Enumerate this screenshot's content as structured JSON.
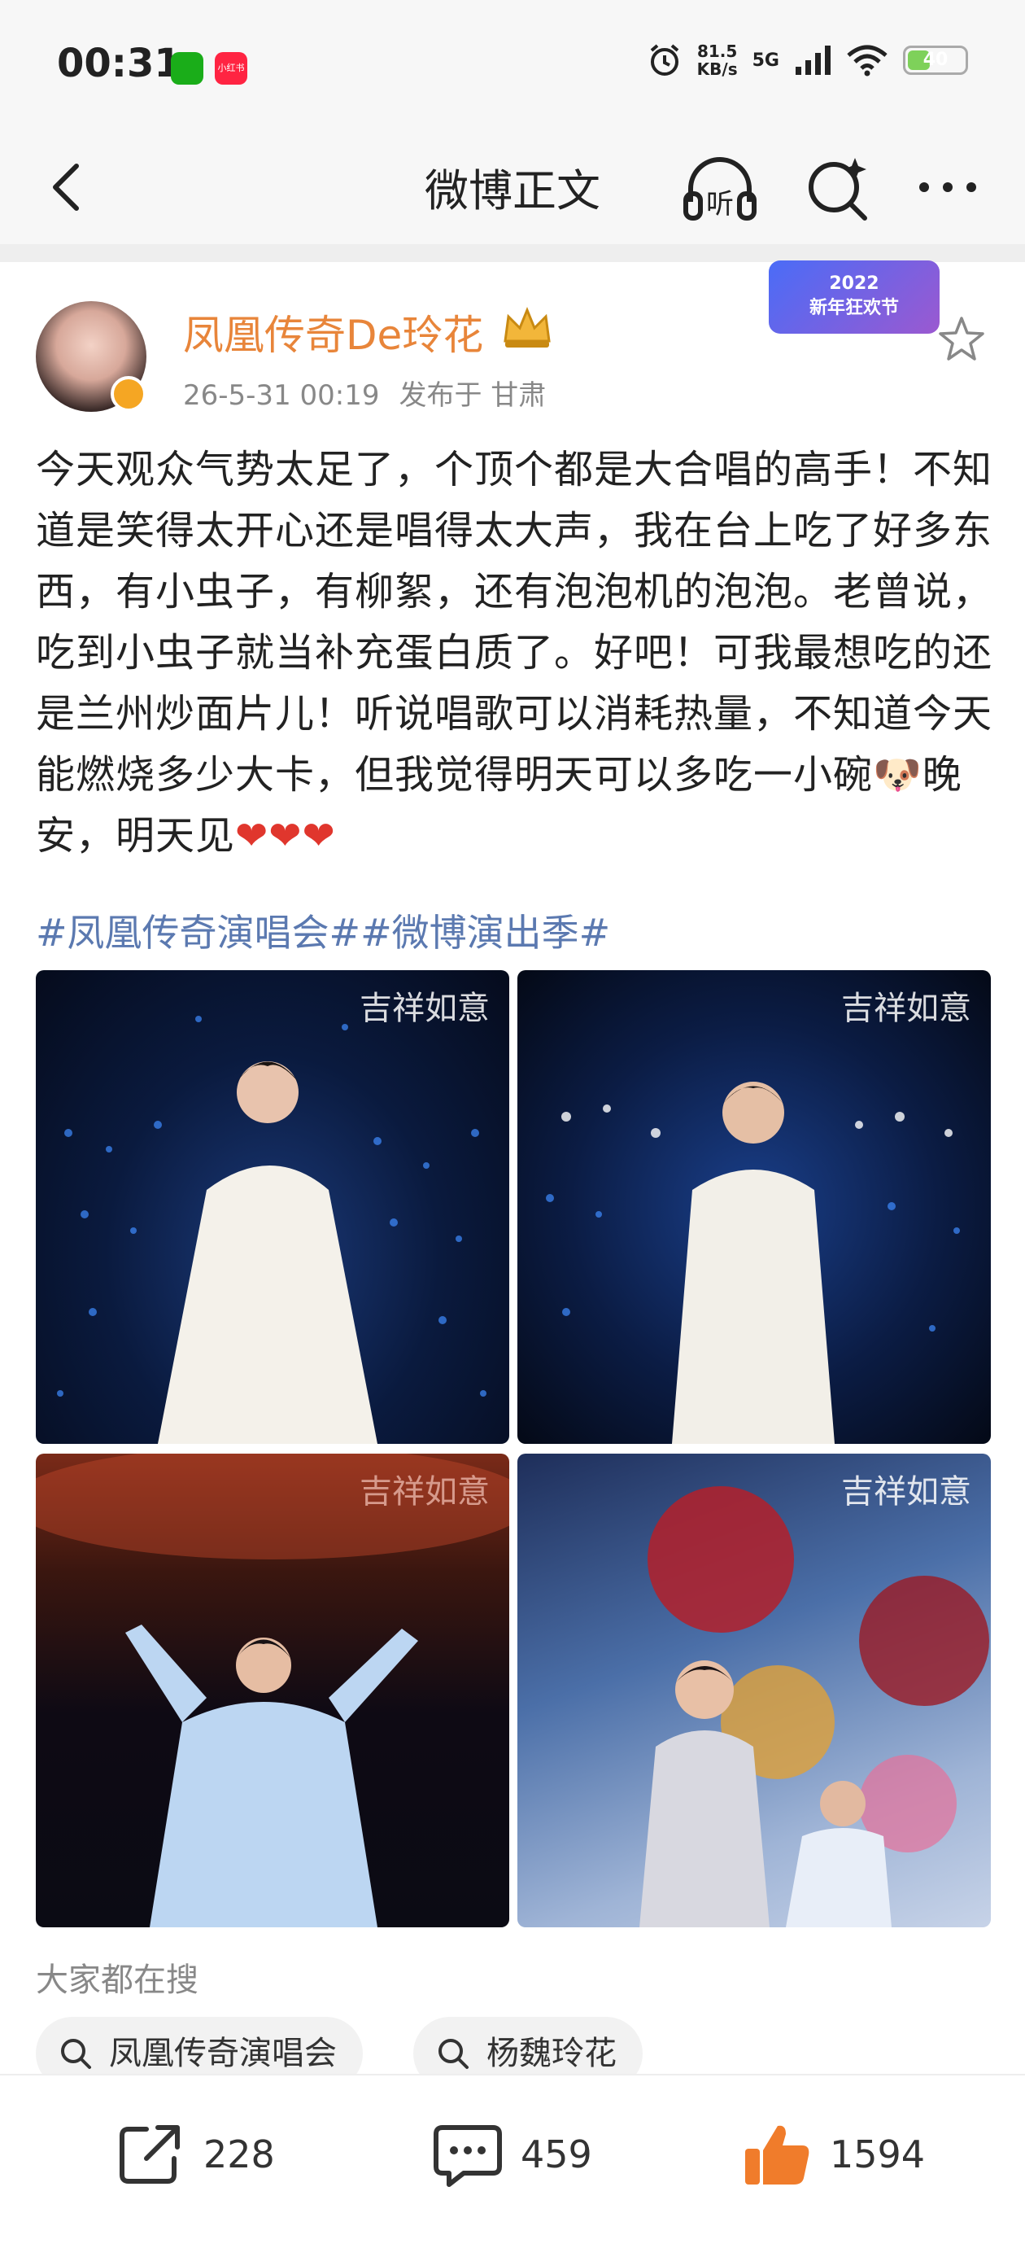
{
  "status_bar": {
    "time": "00:31",
    "app2_label": "小红书",
    "net_speed_value": "81.5",
    "net_speed_unit": "KB/s",
    "network": "5G",
    "battery": "40",
    "battery_level": 0.4
  },
  "nav": {
    "title": "微博正文",
    "listen_label": "听"
  },
  "post": {
    "username": "凤凰传奇De玲花",
    "time": "26-5-31 00:19",
    "location": "发布于 甘肃",
    "badge_year": "2022",
    "badge_text": "新年狂欢节",
    "text": "今天观众气势太足了，个顶个都是大合唱的高手！不知道是笑得太开心还是唱得太大声，我在台上吃了好多东西，有小虫子，有柳絮，还有泡泡机的泡泡。老曾说，吃到小虫子就当补充蛋白质了。好吧！可我最想吃的还是兰州炒面片儿！听说唱歌可以消耗热量，不知道今天能燃烧多少大卡，但我觉得明天可以多吃一小碗🐶晚安，明天见",
    "hearts": "❤❤❤",
    "topics": "#凤凰传奇演唱会##微博演出季#",
    "watermark": "吉祥如意"
  },
  "search": {
    "label": "大家都在搜",
    "chips": [
      "凤凰传奇演唱会",
      "杨魏玲花"
    ]
  },
  "actions": {
    "repost_count": "228",
    "comment_count": "459",
    "like_count": "1594"
  },
  "colors": {
    "username": "#e8853a",
    "topic": "#5b79b0",
    "like": "#f07c2b"
  }
}
